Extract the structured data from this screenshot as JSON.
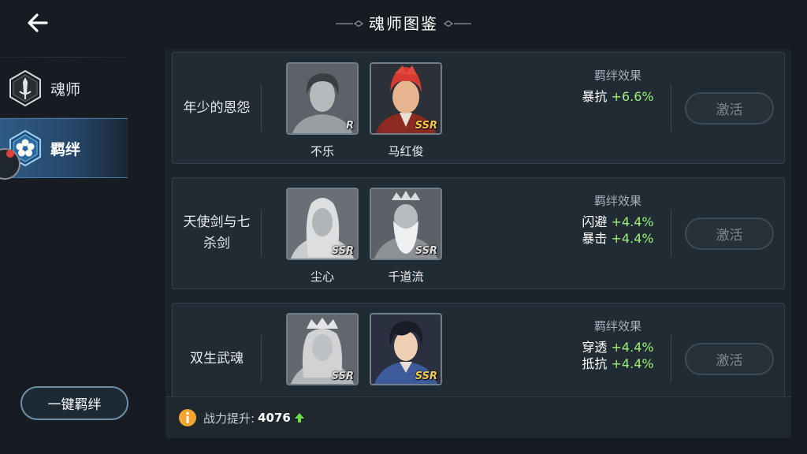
{
  "header": {
    "title": "魂师图鉴"
  },
  "sidebar": {
    "items": [
      {
        "label": "魂师",
        "icon": "sword-emblem-icon",
        "active": false
      },
      {
        "label": "羁绊",
        "icon": "flower-emblem-icon",
        "active": true
      }
    ],
    "onekey_label": "一键羁绊"
  },
  "bonds": [
    {
      "name": "年少的恩怨",
      "heroes": [
        {
          "name": "不乐",
          "rarity": "R",
          "colored": false
        },
        {
          "name": "马红俊",
          "rarity": "SSR",
          "colored": true
        }
      ],
      "effect_title": "羁绊效果",
      "effects": [
        {
          "stat": "暴抗",
          "value": "+6.6%"
        }
      ],
      "activate_label": "激活"
    },
    {
      "name": "天使剑与七杀剑",
      "heroes": [
        {
          "name": "尘心",
          "rarity": "SSR",
          "colored": false
        },
        {
          "name": "千道流",
          "rarity": "SSR",
          "colored": false
        }
      ],
      "effect_title": "羁绊效果",
      "effects": [
        {
          "stat": "闪避",
          "value": "+4.4%"
        },
        {
          "stat": "暴击",
          "value": "+4.4%"
        }
      ],
      "activate_label": "激活"
    },
    {
      "name": "双生武魂",
      "heroes": [
        {
          "name": "",
          "rarity": "SSR",
          "colored": false
        },
        {
          "name": "",
          "rarity": "SSR",
          "colored": true
        }
      ],
      "effect_title": "羁绊效果",
      "effects": [
        {
          "stat": "穿透",
          "value": "+4.4%"
        },
        {
          "stat": "抵抗",
          "value": "+4.4%"
        }
      ],
      "activate_label": "激活"
    }
  ],
  "footer": {
    "power_label": "战力提升:",
    "power_value": "4076"
  },
  "colors": {
    "accent_blue": "#2f5a85",
    "bonus_green": "#9ff07a",
    "gold_rarity": "#f2c94a",
    "info_orange": "#f2a531"
  }
}
